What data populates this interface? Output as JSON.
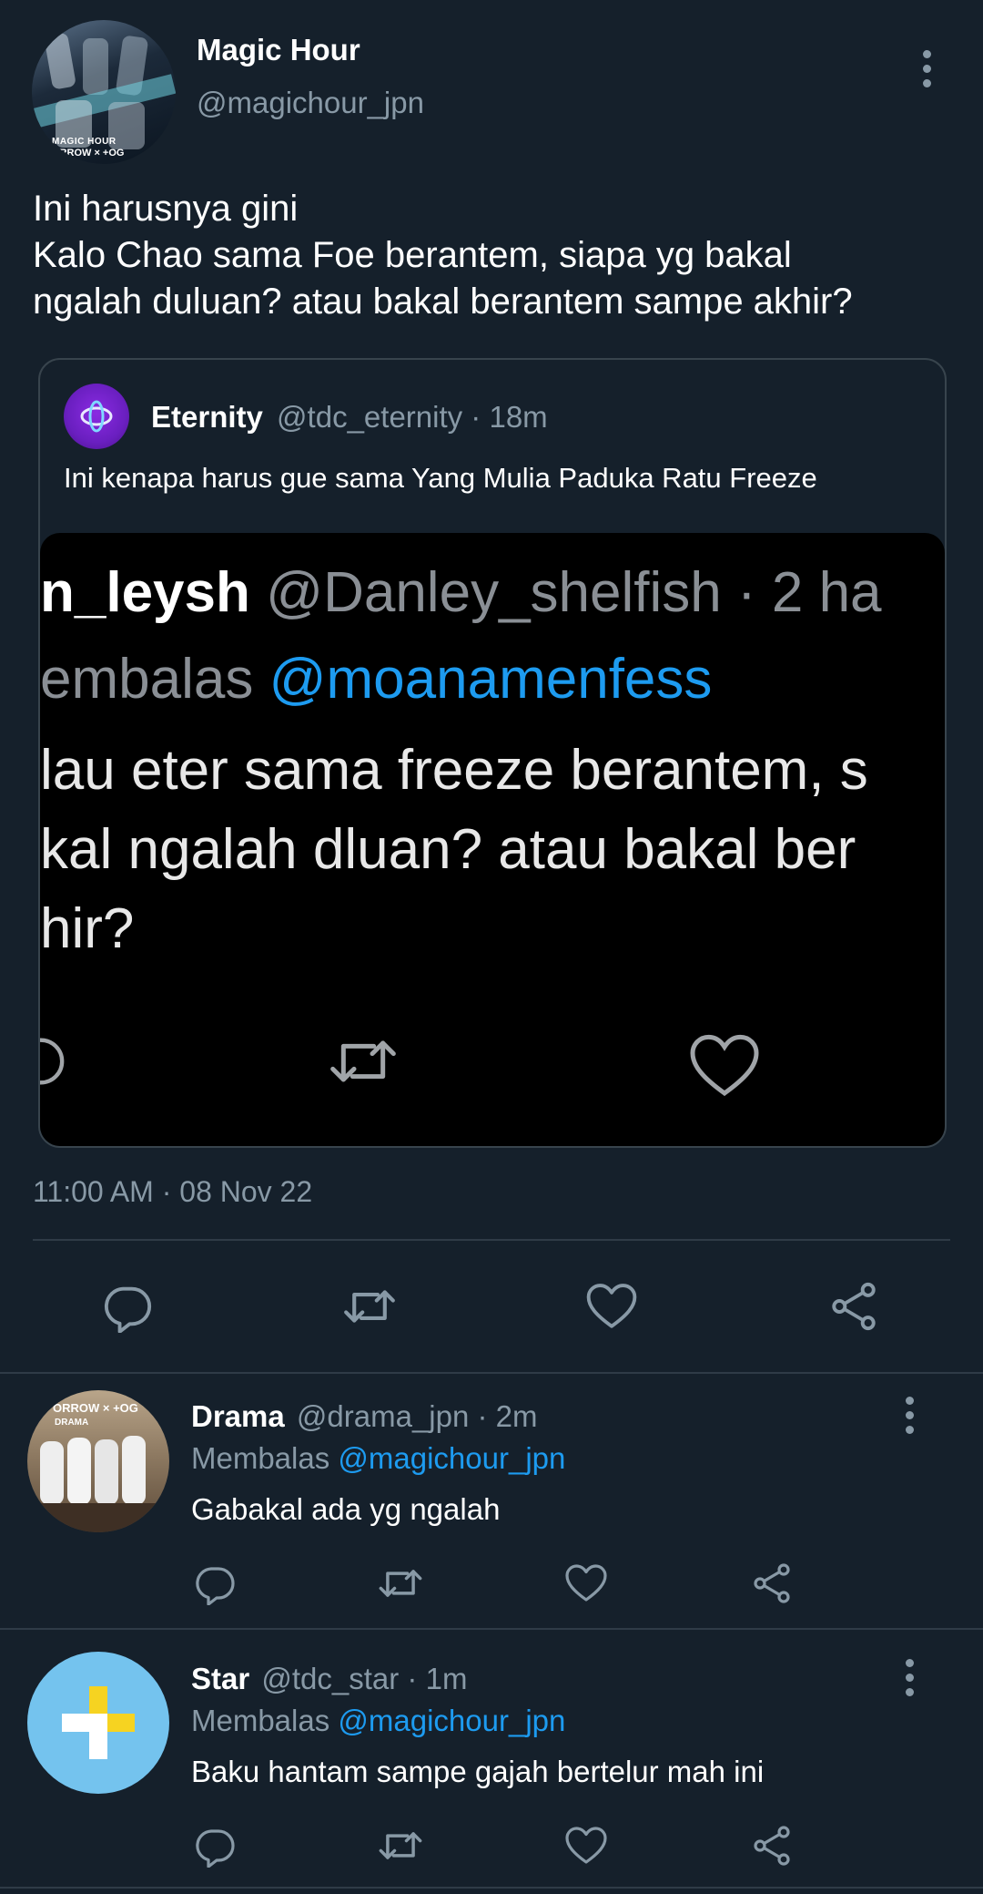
{
  "main_tweet": {
    "display_name": "Magic Hour",
    "handle": "@magichour_jpn",
    "avatar_text_1": "MAGIC HOUR",
    "avatar_text_2": "ORROW × +OG",
    "text_lines": [
      "Ini harusnya gini",
      "Kalo Chao sama Foe berantem, siapa yg bakal",
      "ngalah duluan? atau bakal berantem sampe akhir?"
    ],
    "timestamp": "11:00 AM · 08 Nov 22"
  },
  "quoted_tweet": {
    "display_name": "Eternity",
    "meta": "@tdc_eternity · 18m",
    "text": "Ini kenapa harus gue sama Yang Mulia Paduka Ratu Freeze",
    "image": {
      "line1_name": "n_leysh",
      "line1_rest": " @Danley_shelfish · 2 ha",
      "line2_prefix": "embalas ",
      "line2_mention": "@moanamenfess",
      "line3": "lau eter sama freeze berantem, s",
      "line4": "kal ngalah dluan? atau bakal ber",
      "line5": "hir?"
    }
  },
  "replies": [
    {
      "display_name": "Drama",
      "meta": "@drama_jpn · 2m",
      "replying_prefix": "Membalas ",
      "replying_to": "@magichour_jpn",
      "text": "Gabakal ada yg ngalah",
      "avatar_text_1": "ORROW × +OG",
      "avatar_text_2": "DRAMA"
    },
    {
      "display_name": "Star",
      "meta": "@tdc_star · 1m",
      "replying_prefix": "Membalas ",
      "replying_to": "@magichour_jpn",
      "text": "Baku hantam sampe gajah bertelur mah ini"
    }
  ],
  "icons": {
    "reply": "reply-icon",
    "retweet": "retweet-icon",
    "like": "heart-icon",
    "share": "share-icon",
    "more": "more-vertical-icon"
  },
  "colors": {
    "background": "#15202b",
    "text": "#ffffff",
    "secondary": "#8899a6",
    "accent": "#1d9bf0",
    "divider": "#2f3b47"
  }
}
